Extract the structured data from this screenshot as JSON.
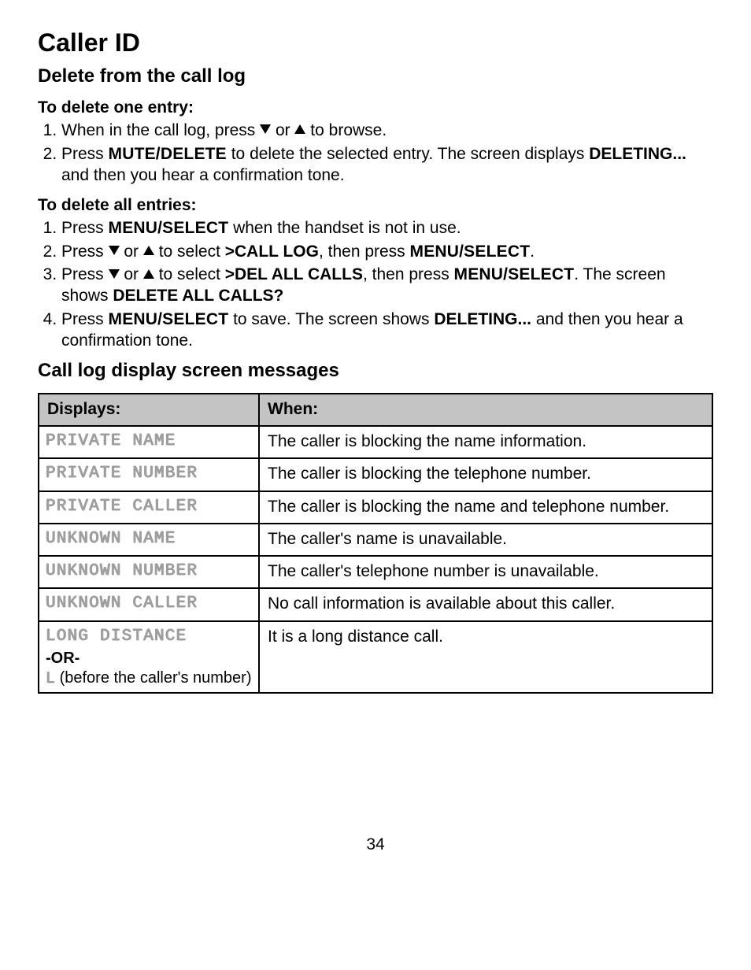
{
  "title": "Caller ID",
  "section1": {
    "heading": "Delete from the call log",
    "sub1": {
      "heading": "To delete one entry:",
      "step1_pre": "When in the call log, press ",
      "step1_mid": " or ",
      "step1_post": " to browse.",
      "step2_a": "Press ",
      "step2_key1": "MUTE/DELETE",
      "step2_b": " to delete the selected entry. The screen displays ",
      "step2_key2": "DELETING...",
      "step2_c": " and then you hear a confirmation tone."
    },
    "sub2": {
      "heading": "To delete all entries:",
      "s1_a": "Press ",
      "s1_key": "MENU/SELECT",
      "s1_b": " when the handset is not in use.",
      "s2_a": "Press ",
      "s2_mid": " or ",
      "s2_b": " to select ",
      "s2_key1": ">CALL LOG",
      "s2_c": ", then press ",
      "s2_key2": "MENU/SELECT",
      "s2_d": ".",
      "s3_a": "Press ",
      "s3_mid": " or ",
      "s3_b": " to select ",
      "s3_key1": ">DEL ALL CALLS",
      "s3_c": ", then press ",
      "s3_key2": "MENU/SELECT",
      "s3_d": ". The screen shows ",
      "s3_key3": "DELETE ALL CALLS?",
      "s4_a": "Press ",
      "s4_key1": "MENU/SELECT",
      "s4_b": " to save. The screen shows ",
      "s4_key2": "DELETING...",
      "s4_c": " and then you hear a confirmation tone."
    }
  },
  "section2": {
    "heading": "Call log display screen messages",
    "header_col1": "Displays:",
    "header_col2": "When:",
    "rows": [
      {
        "display": "PRIVATE NAME",
        "when": "The caller is blocking the name information."
      },
      {
        "display": "PRIVATE NUMBER",
        "when": "The caller is blocking the telephone number."
      },
      {
        "display": "PRIVATE CALLER",
        "when": "The caller is blocking the name and telephone number."
      },
      {
        "display": "UNKNOWN NAME",
        "when": "The caller's name is unavailable."
      },
      {
        "display": "UNKNOWN NUMBER",
        "when": "The caller's telephone number is unavailable."
      },
      {
        "display": "UNKNOWN CALLER",
        "when": "No call information is available about this caller."
      }
    ],
    "lastrow": {
      "display": "LONG DISTANCE",
      "or": "-OR-",
      "sub_pre_glyph": "L",
      "sub_post": " (before the caller's number)",
      "when": "It is a long distance call."
    }
  },
  "pagenum": "34"
}
